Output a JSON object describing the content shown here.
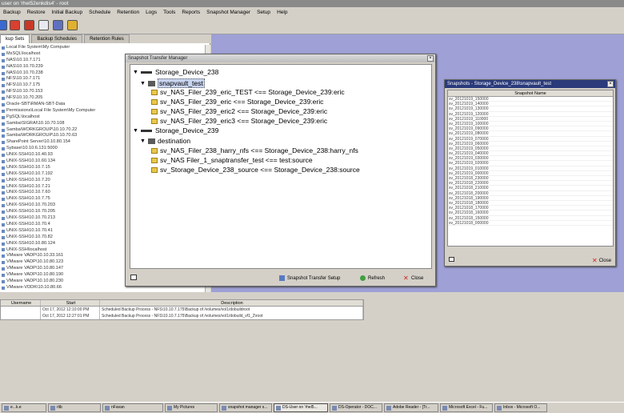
{
  "window": {
    "title": "user on 'rhel52enkdis4' - root"
  },
  "menu": [
    "Backup",
    "Restore",
    "Initial Backup",
    "Schedule",
    "Retention",
    "Logs",
    "Tools",
    "Reports",
    "Snapshot Manager",
    "Setup",
    "Help"
  ],
  "tabs": [
    "kup Sets",
    "Backup Schedules",
    "Retention Rules"
  ],
  "sources": [
    "Local File System\\My Computer",
    "MsSQL\\localhost",
    "NAS\\10.10.7.171",
    "NAS\\10.10.70.239",
    "NAS\\10.10.70.238",
    "NFS\\10.10.7.171",
    "NFS\\10.10.7.175",
    "NFS\\10.10.70.153",
    "NFS\\10.10.70.205",
    "Oracle-SBT\\RMAN-SBT-Data",
    "Permissions\\Local File System\\My Computer",
    "PgSQL\\localhost",
    "Samba\\SIGRAI\\10.10.70.108",
    "Samba\\WORKGROUP\\10.10.70.22",
    "Samba\\WORKGROUP\\10.10.70.63",
    "SharePoint Server\\10.10.80.154",
    "Sybase\\10.10.6.131:5000",
    "UNIX-SSH\\10.10.40.93",
    "UNIX-SSH\\10.10.60.134",
    "UNIX-SSH\\10.10.7.15",
    "UNIX-SSH\\10.10.7.192",
    "UNIX-SSH\\10.10.7.20",
    "UNIX-SSH\\10.10.7.21",
    "UNIX-SSH\\10.10.7.60",
    "UNIX-SSH\\10.10.7.75",
    "UNIX-SSH\\10.10.70.203",
    "UNIX-SSH\\10.10.70.205",
    "UNIX-SSH\\10.10.70.213",
    "UNIX-SSH\\10.10.70.4",
    "UNIX-SSH\\10.10.70.41",
    "UNIX-SSH\\10.10.70.82",
    "UNIX-SSH\\10.10.80.124",
    "UNIX-SSH\\localhost",
    "VMware VADP\\10.10.33.161",
    "VMware VADP\\10.10.80.123",
    "VMware VADP\\10.10.80.147",
    "VMware VADP\\10.10.80.190",
    "VMware VADP\\10.10.80.230",
    "VMware-VDDK\\10.10.80.66"
  ],
  "transfer_dialog": {
    "title": "Snapshot Transfer Manager",
    "device1": "Storage_Device_238",
    "group1": "snapvault_test",
    "items1": [
      "sv_NAS_Filer_239_eric_TEST <== Storage_Device_239:eric",
      "sv_NAS_Filer_239_eric <== Storage_Device_239:eric",
      "sv_NAS_Filer_239_eric2 <== Storage_Device_239:eric",
      "sv_NAS_Filer_239_eric3 <== Storage_Device_239:eric"
    ],
    "device2": "Storage_Device_239",
    "group2": "destination",
    "items2": [
      "sv_NAS_Filer_238_harry_nfs <== Storage_Device_238:harry_nfs",
      "sv_NAS Filer_1_snaptransfer_test <== test:source",
      "sv_Storage_Device_238_source <== Storage_Device_238:source"
    ],
    "setup_label": "Snapshot Transfer Setup",
    "refresh_label": "Refresh",
    "close_label": "Close"
  },
  "snapshots_dialog": {
    "title": "Snapshots - Storage_Device_238\\snapvault_test",
    "column": "Snapshot Name",
    "rows": [
      "sv_20121019_150000",
      "sv_20121019_140000",
      "sv_20121019_130000",
      "sv_20121019_120000",
      "sv_20121019_110000",
      "sv_20121019_100000",
      "sv_20121019_090000",
      "sv_20121019_080000",
      "sv_20121019_070000",
      "sv_20121019_060000",
      "sv_20121019_050000",
      "sv_20121019_040000",
      "sv_20121019_030000",
      "sv_20121019_020000",
      "sv_20121019_010000",
      "sv_20121019_000000",
      "sv_20121018_230000",
      "sv_20121018_220000",
      "sv_20121018_210000",
      "sv_20121018_200000",
      "sv_20121018_190000",
      "sv_20121018_180000",
      "sv_20121018_170000",
      "sv_20121018_160000",
      "sv_20121018_150000",
      "sv_20121018_000000"
    ],
    "close_label": "Close"
  },
  "jobs": {
    "headers": [
      "Username",
      "Start",
      "Description"
    ],
    "rows": [
      [
        "",
        "Oct 17, 2012 12:10:00 PM",
        "Scheduled Backup Process - NFS\\10.10.7.175\\Backup of /volumes/vol1/dobuildroot"
      ],
      [
        "",
        "Oct 17, 2012 12:27:01 PM",
        "Scheduled Backup Process - NFS\\10.10.7.175\\Backup of /volumes/vol1/dobuild_vf1_2\\root"
      ]
    ]
  },
  "taskbar": [
    "e...k.e",
    "rlib",
    "nFavan",
    "My Pictures",
    "snapshot manager s...",
    "DS-User on 'rhel5...",
    "DS-Operator - DOC...",
    "Adobe Reader - [Tr...",
    "Microsoft Excel - Fu...",
    "Inbox - Microsoft O..."
  ],
  "colors": {
    "desktop": "#9ea0d6",
    "chrome": "#d4d0c8",
    "selection": "#c8d4f0"
  }
}
